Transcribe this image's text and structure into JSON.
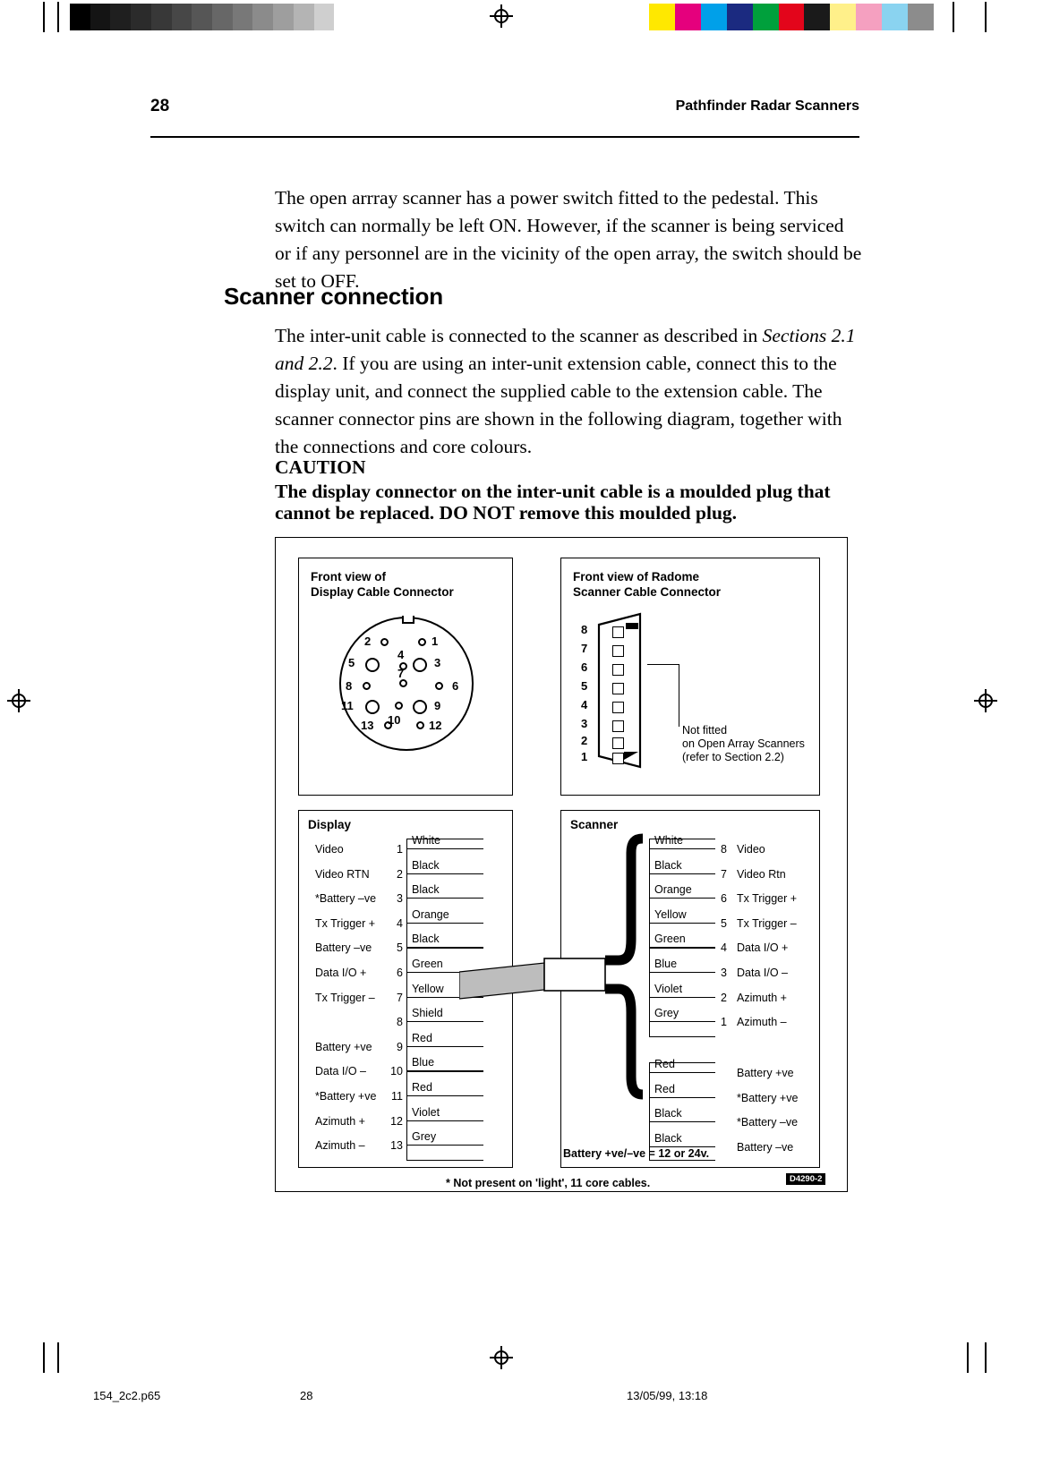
{
  "page": {
    "number": "28",
    "running_head": "Pathfinder Radar Scanners"
  },
  "intro_paragraph": "The open arrray scanner has a power switch fitted to the pedestal. This switch can normally be left ON. However, if the scanner is being serviced or if any personnel are in the vicinity of the open array, the switch should be set to OFF.",
  "heading": "Scanner connection",
  "para2": {
    "part1": "The inter-unit cable is connected to the scanner as described in ",
    "italic": "Sections 2.1 and 2.2",
    "part2": ". If you are using an inter-unit extension cable, connect this to the display unit, and connect the supplied cable to the extension cable. The scanner connector pins  are shown in the following diagram, together with the connections and core colours."
  },
  "caution": {
    "title": "CAUTION",
    "line1": "The display connector on the inter-unit cable is a moulded plug that",
    "line2": "cannot be replaced. DO NOT remove this moulded plug."
  },
  "diagram": {
    "display_connector_title_line1": "Front view of",
    "display_connector_title_line2": "Display Cable Connector",
    "radome_connector_title_line1": "Front view of Radome",
    "radome_connector_title_line2": "Scanner Cable Connector",
    "display_pin_numbers": [
      "1",
      "2",
      "3",
      "4",
      "5",
      "6",
      "7",
      "8",
      "9",
      "10",
      "11",
      "12",
      "13"
    ],
    "radome_pin_numbers": [
      "8",
      "7",
      "6",
      "5",
      "4",
      "3",
      "2",
      "1"
    ],
    "radome_note_line1": "Not fitted",
    "radome_note_line2": "on Open Array Scanners",
    "radome_note_line3": "(refer to Section 2.2)",
    "display_section_title": "Display",
    "scanner_section_title": "Scanner",
    "display_rows": [
      {
        "signal": "Video",
        "pin": "1",
        "colour": "White"
      },
      {
        "signal": "Video RTN",
        "pin": "2",
        "colour": "Black"
      },
      {
        "signal": "*Battery –ve",
        "pin": "3",
        "colour": "Black"
      },
      {
        "signal": "Tx Trigger +",
        "pin": "4",
        "colour": "Orange"
      },
      {
        "signal": "Battery –ve",
        "pin": "5",
        "colour": "Black"
      },
      {
        "signal": "Data I/O +",
        "pin": "6",
        "colour": "Green"
      },
      {
        "signal": "Tx Trigger –",
        "pin": "7",
        "colour": "Yellow"
      },
      {
        "signal": "",
        "pin": "8",
        "colour": "Shield"
      },
      {
        "signal": "Battery +ve",
        "pin": "9",
        "colour": "Red"
      },
      {
        "signal": "Data I/O –",
        "pin": "10",
        "colour": "Blue"
      },
      {
        "signal": "*Battery +ve",
        "pin": "11",
        "colour": "Red"
      },
      {
        "signal": "Azimuth +",
        "pin": "12",
        "colour": "Violet"
      },
      {
        "signal": "Azimuth –",
        "pin": "13",
        "colour": "Grey"
      }
    ],
    "scanner_signal_rows": [
      {
        "colour": "White",
        "pin": "8",
        "signal": "Video"
      },
      {
        "colour": "Black",
        "pin": "7",
        "signal": "Video Rtn"
      },
      {
        "colour": "Orange",
        "pin": "6",
        "signal": "Tx Trigger +"
      },
      {
        "colour": "Yellow",
        "pin": "5",
        "signal": "Tx Trigger –"
      },
      {
        "colour": "Green",
        "pin": "4",
        "signal": "Data I/O +"
      },
      {
        "colour": "Blue",
        "pin": "3",
        "signal": "Data I/O –"
      },
      {
        "colour": "Violet",
        "pin": "2",
        "signal": "Azimuth +"
      },
      {
        "colour": "Grey",
        "pin": "1",
        "signal": "Azimuth –"
      }
    ],
    "scanner_power_rows": [
      {
        "colour": "Red",
        "signal": "Battery +ve"
      },
      {
        "colour": "Red",
        "signal": "*Battery +ve"
      },
      {
        "colour": "Black",
        "signal": "*Battery –ve"
      },
      {
        "colour": "Black",
        "signal": "Battery –ve"
      }
    ],
    "battery_note": "Battery +ve/–ve = 12 or 24v.",
    "footnote": "* Not present on 'light', 11 core cables.",
    "drawing_code": "D4290-2"
  },
  "print_footer": {
    "filename": "154_2c2.p65",
    "page": "28",
    "timestamp": "13/05/99, 13:18"
  },
  "colours": {
    "grey_bar": [
      "#000000",
      "#141414",
      "#1f1f1f",
      "#2b2b2b",
      "#383838",
      "#474747",
      "#565656",
      "#676767",
      "#787878",
      "#8b8b8b",
      "#9e9e9e",
      "#b4b4b4",
      "#cfcfcf",
      "#ffffff"
    ],
    "colour_bar": [
      "#ffe800",
      "#e5007d",
      "#00a0e9",
      "#1b2a80",
      "#00a03c",
      "#e3051b",
      "#1a1a1a",
      "#fff08a",
      "#f5a0c0",
      "#8ad3f0",
      "#8c8c8c"
    ]
  }
}
